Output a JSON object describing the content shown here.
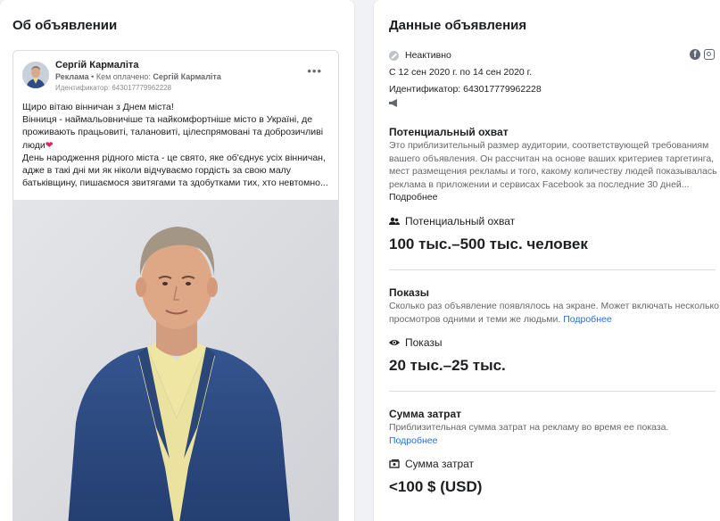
{
  "left_panel": {
    "title": "Об объявлении",
    "ad": {
      "page_name": "Сергій Кармаліта",
      "sponsored_label": "Реклама",
      "paid_by_prefix": " • Кем оплачено: ",
      "paid_by_name": "Сергій Кармаліта",
      "ad_id_label": "Идентификатор: 643017779962228",
      "more_icon": "more-horizontal-icon",
      "text_lines": [
        "Щиро вітаю вінничан з Днем міста!",
        "Вінниця - наймальовничіше та найкомфортніше місто в Україні, де проживають працьовиті, талановиті, цілеспрямовані та доброзичливі люди",
        "День народження рідного міста - це свято, яке об'єднує усіх вінничан, адже в такі дні ми як ніколи відчуваємо гордість за свою малу батьківщину, пишаємося звитягами та здобутками тих, хто невтомно..."
      ],
      "heart_glyph": "❤"
    }
  },
  "right_panel": {
    "title": "Данные объявления",
    "status": "Неактивно",
    "date_range": "С 12 сен 2020 г. по 14 сен 2020 г.",
    "id_line": "Идентификатор: 643017779962228",
    "platform_icons": [
      "facebook-icon",
      "instagram-icon"
    ],
    "reach": {
      "title": "Потенциальный охват",
      "description": "Это приблизительный размер аудитории, соответствующей требованиям вашего объявления. Он рассчитан на основе ваших критериев таргетинга, мест размещения рекламы и того, какому количеству людей показывалась реклама в приложении и сервисах Facebook за последние 30 дней...",
      "more_link": "Подробнее",
      "metric_label": "Потенциальный охват",
      "metric_value": "100 тыс.–500 тыс. человек"
    },
    "impressions": {
      "title": "Показы",
      "description": "Сколько раз объявление появлялось на экране. Может включать несколько просмотров одними и теми же людьми.",
      "more_link": "Подробнее",
      "metric_label": "Показы",
      "metric_value": "20 тыс.–25 тыс."
    },
    "spend": {
      "title": "Сумма затрат",
      "description": "Приблизительная сумма затрат на рекламу во время ее показа.",
      "more_link": "Подробнее",
      "metric_label": "Сумма затрат",
      "metric_value": "<100 $ (USD)"
    }
  },
  "colors": {
    "link": "#216fdb",
    "background": "#f0f2f5",
    "muted_text": "#65676b"
  }
}
